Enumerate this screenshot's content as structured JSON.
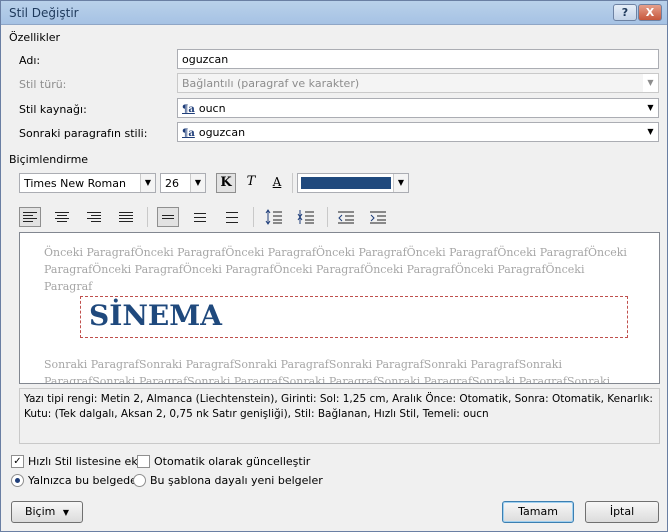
{
  "window": {
    "title": "Stil Değiştir"
  },
  "titlebar": {
    "help_label": "?",
    "close_label": "X"
  },
  "properties": {
    "group_label": "Özellikler",
    "name": {
      "label": "Adı:",
      "value": "oguzcan"
    },
    "style_type": {
      "label": "Stil türü:",
      "value": "Bağlantılı (paragraf ve karakter)"
    },
    "style_based_on": {
      "label": "Stil kaynağı:",
      "value": "oucn"
    },
    "next_paragraph_style": {
      "label": "Sonraki paragrafın stili:",
      "value": "oguzcan"
    },
    "style_icon_text": "¶a"
  },
  "formatting": {
    "group_label": "Biçimlendirme",
    "font_name": "Times New Roman",
    "font_size": "26",
    "bold_label": "K",
    "italic_label": "T",
    "underline_label": "A",
    "font_color": "#1f497d"
  },
  "preview": {
    "previous_text": "Önceki ParagrafÖnceki ParagrafÖnceki ParagrafÖnceki ParagrafÖnceki ParagrafÖnceki ParagrafÖnceki ParagrafÖnceki ParagrafÖnceki ParagrafÖnceki ParagrafÖnceki ParagrafÖnceki ParagrafÖnceki Paragraf",
    "sample_text": "SİNEMA",
    "next_text": "Sonraki ParagrafSonraki ParagrafSonraki ParagrafSonraki ParagrafSonraki ParagrafSonraki ParagrafSonraki ParagrafSonraki ParagrafSonraki ParagrafSonraki ParagrafSonraki ParagrafSonraki ParagrafSonraki Paragraf"
  },
  "description": "Yazı tipi rengi: Metin 2, Almanca (Liechtenstein), Girinti: Sol:  1,25 cm, Aralık Önce:  Otomatik, Sonra:  Otomatik, Kenarlık: Kutu: (Tek dalgalı, Aksan 2,  0,75 nk Satır genişliği), Stil: Bağlanan, Hızlı Stil, Temeli: oucn",
  "options": {
    "add_quick_style": {
      "label": "Hızlı Stil listesine ekle",
      "checked": true
    },
    "auto_update": {
      "label": "Otomatik olarak güncelleştir",
      "checked": false
    },
    "only_this_document": {
      "label": "Yalnızca bu belgede",
      "selected": true
    },
    "new_documents_template": {
      "label": "Bu şablona dayalı yeni belgeler",
      "selected": false
    }
  },
  "buttons": {
    "format": "Biçim",
    "ok": "Tamam",
    "cancel": "İptal"
  }
}
